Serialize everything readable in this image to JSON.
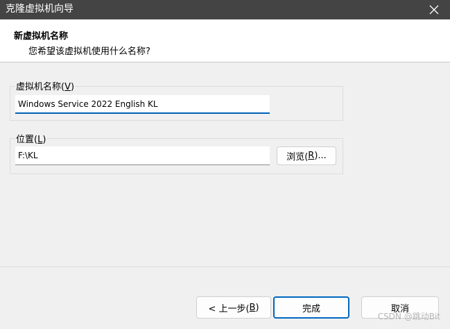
{
  "window": {
    "title": "克隆虚拟机向导",
    "close_icon": "close-icon"
  },
  "header": {
    "title": "新虚拟机名称",
    "subtitle": "您希望该虚拟机使用什么名称?"
  },
  "name_group": {
    "label": "虚拟机名称",
    "mnemonic_open": "(",
    "mnemonic_key": "V",
    "mnemonic_close": ")",
    "value": "Windows Service 2022 English KL"
  },
  "location_group": {
    "label": "位置",
    "mnemonic_open": "(",
    "mnemonic_key": "L",
    "mnemonic_close": ")",
    "value": "F:\\KL",
    "browse_label": "浏览(",
    "browse_key": "R",
    "browse_suffix": ")..."
  },
  "footer": {
    "back_label": "< 上一步(",
    "back_key": "B",
    "back_suffix": ")",
    "finish_label": "完成",
    "cancel_label": "取消"
  },
  "watermark": "CSDN @跳动Bit",
  "colors": {
    "titlebar": "#444444",
    "accent": "#005fb8",
    "background": "#f0f0f0"
  }
}
